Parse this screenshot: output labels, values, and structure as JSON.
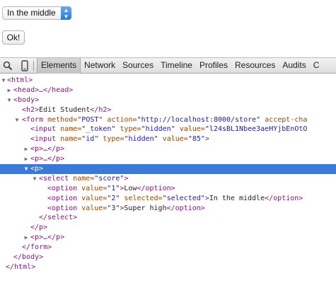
{
  "page": {
    "select_value": "In the middle",
    "ok_label": "Ok!"
  },
  "toolbar": {
    "icons": [
      "search-icon",
      "device-mode-icon"
    ],
    "tabs": [
      "Elements",
      "Network",
      "Sources",
      "Timeline",
      "Profiles",
      "Resources",
      "Audits",
      "C"
    ],
    "active_tab": "Elements"
  },
  "tree": {
    "html_open": "<html>",
    "head": "<head>…</head>",
    "body_open": "<body>",
    "h2_open": "<h2>",
    "h2_text": "Edit Student",
    "h2_close": "</h2>",
    "form_open_tag": "<form ",
    "form_attr1": "method=",
    "form_val1": "\"POST\"",
    "form_attr2": " action=",
    "form_val2": "\"http://localhost:8000/store\"",
    "form_attr3": " accept-cha",
    "input1_tag": "<input ",
    "input1_attr1": "name=",
    "input1_val1": "\"_token\"",
    "input1_attr2": " type=",
    "input1_val2": "\"hidden\"",
    "input1_attr3": " value=",
    "input1_val3": "\"l24sBL1Nbee3aeHYjbEnOtO",
    "input2_tag": "<input ",
    "input2_attr1": "name=",
    "input2_val1": "\"id\"",
    "input2_attr2": " type=",
    "input2_val2": "\"hidden\"",
    "input2_attr3": " value=",
    "input2_val3": "\"85\"",
    "input2_end": ">",
    "p_collapsed_1": "<p>…</p>",
    "p_collapsed_2": "<p>…</p>",
    "p_open": "<p>",
    "select_tag": "<select ",
    "select_attr": "name=",
    "select_val": "\"score\"",
    "select_end": ">",
    "opt1_tag": "<option ",
    "opt1_attr": "value=",
    "opt1_val": "\"1\"",
    "opt1_gt": ">",
    "opt1_text": "Low",
    "opt1_close": "</option>",
    "opt2_tag": "<option ",
    "opt2_attr1": "value=",
    "opt2_val1": "\"2\"",
    "opt2_attr2": " selected=",
    "opt2_val2": "\"selected\"",
    "opt2_gt": ">",
    "opt2_text": "In the middle",
    "opt2_close": "</option>",
    "opt3_tag": "<option ",
    "opt3_attr": "value=",
    "opt3_val": "\"3\"",
    "opt3_gt": ">",
    "opt3_text": "Super high",
    "opt3_close": "</option>",
    "select_close": "</select>",
    "p_close": "</p>",
    "p_collapsed_3": "<p>…</p>",
    "form_close": "</form>",
    "body_close": "</body>",
    "html_close": "</html>"
  },
  "colors": {
    "selection": "#3879d9",
    "tag": "#881280",
    "attribute": "#994500",
    "value": "#1a1aa6"
  }
}
